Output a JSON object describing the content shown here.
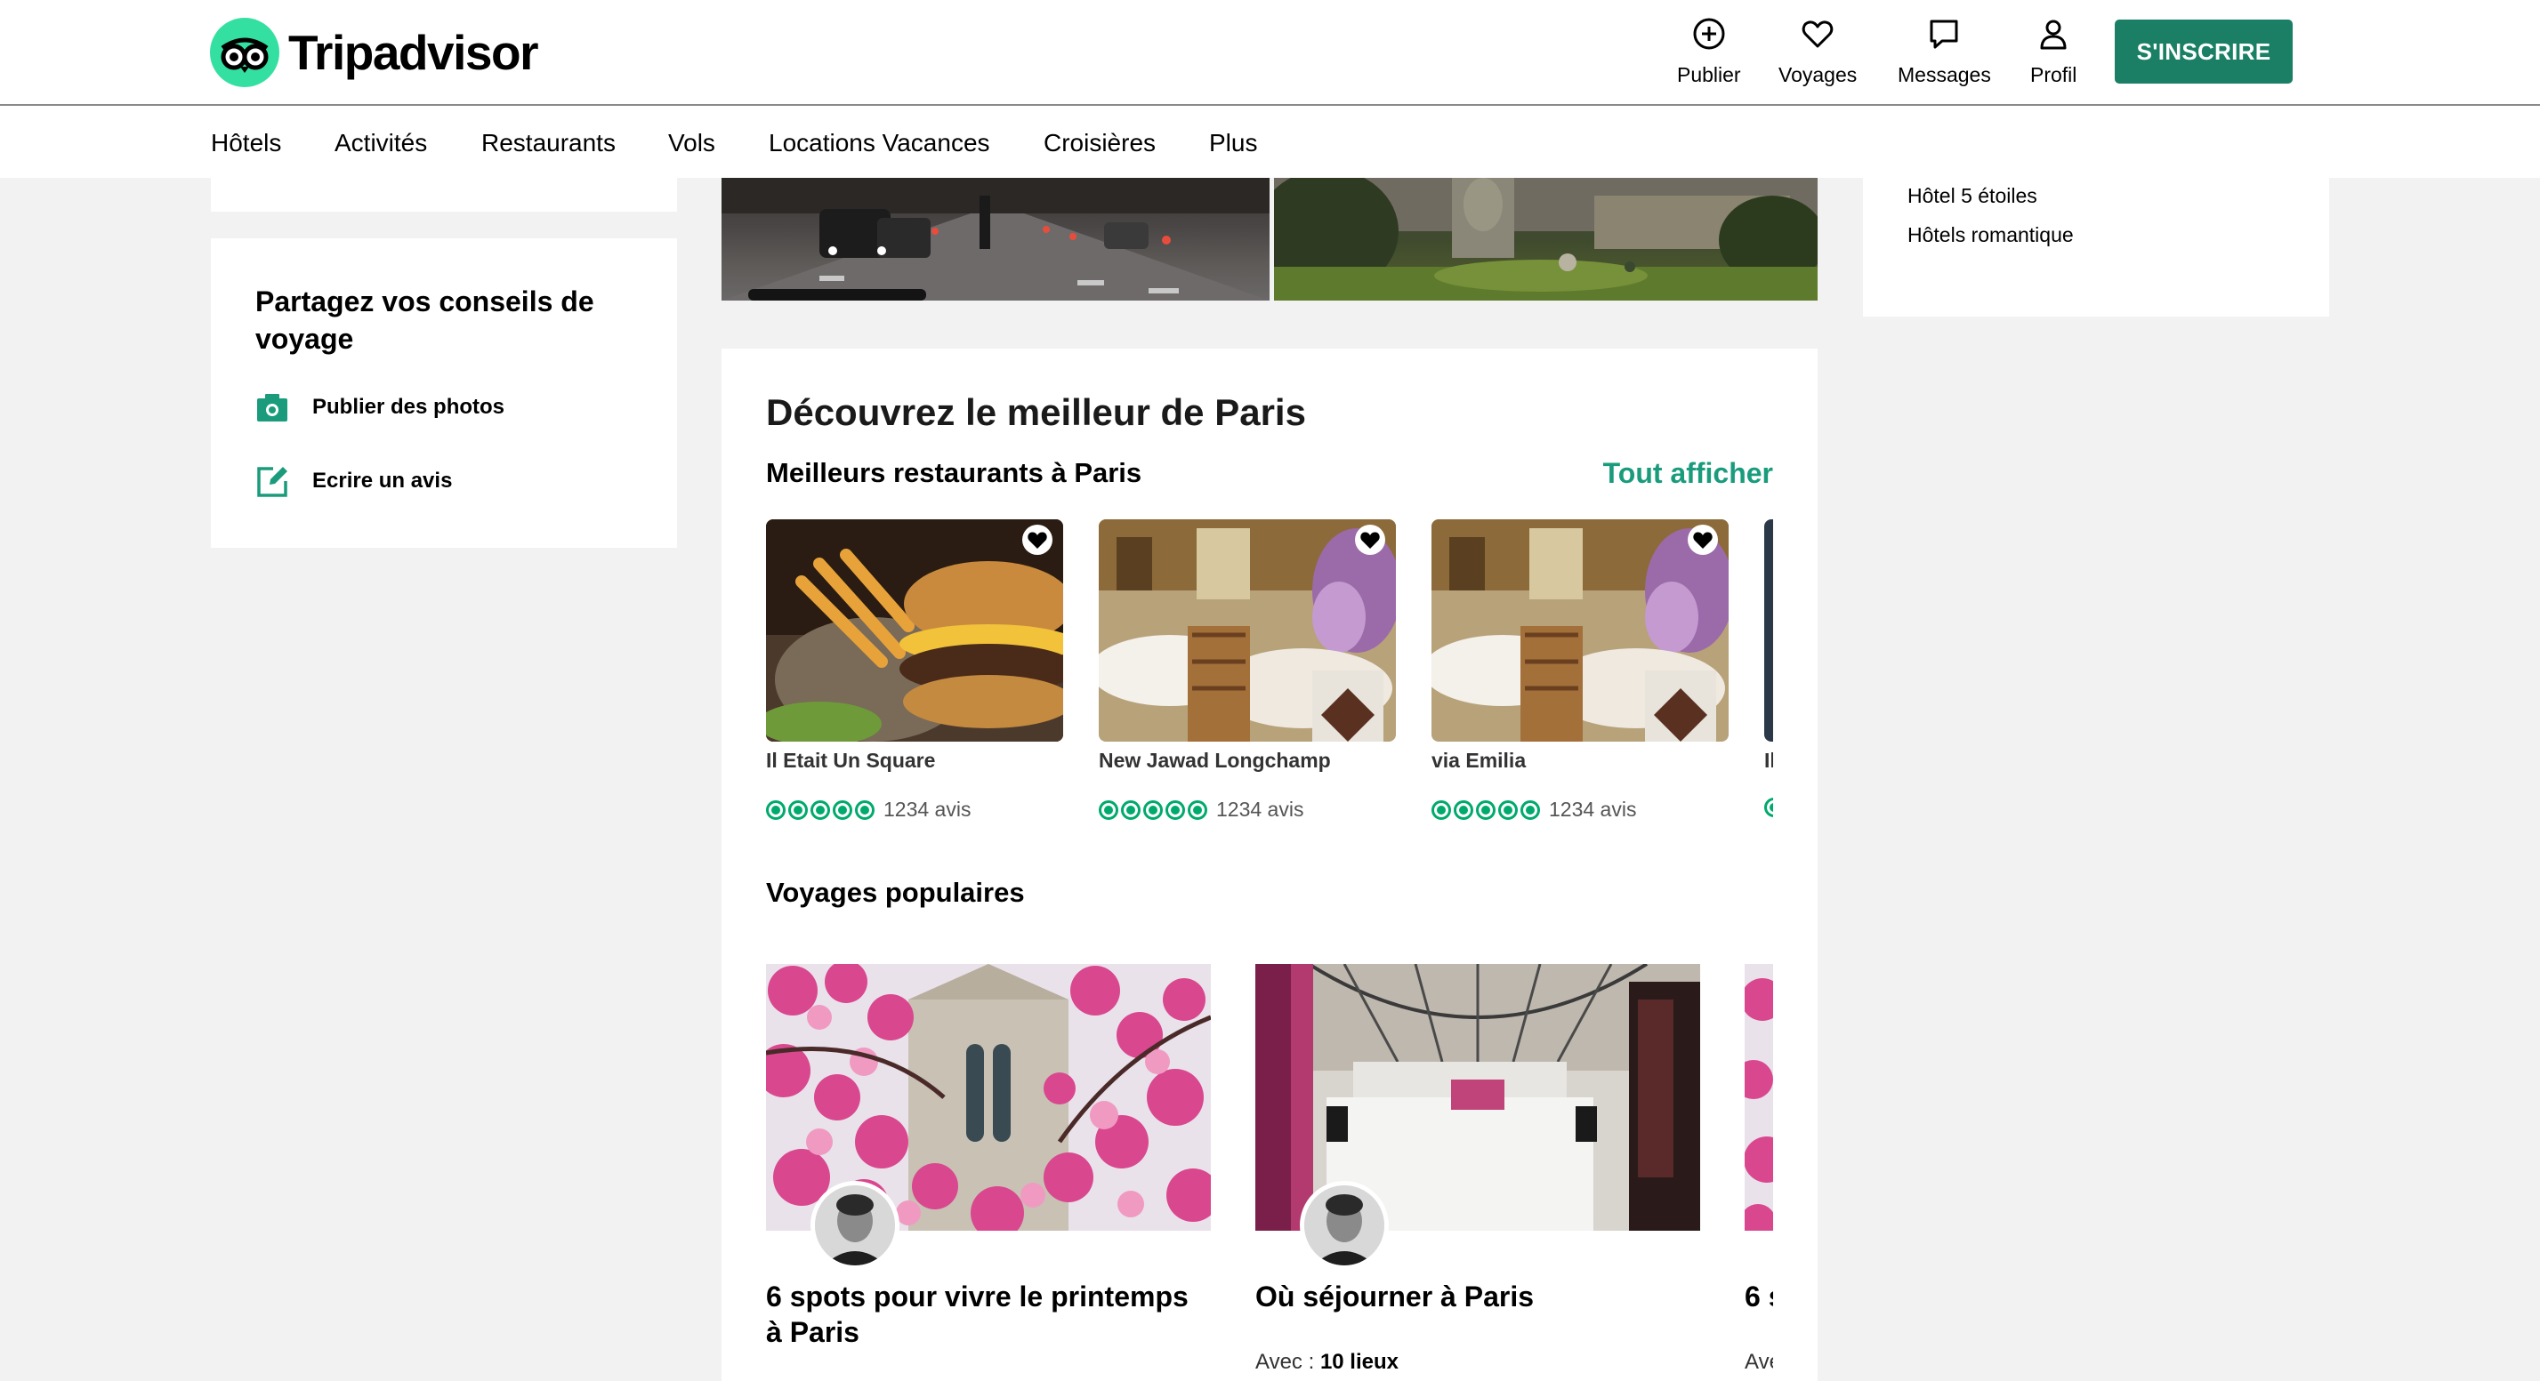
{
  "header": {
    "brand": "Tripadvisor",
    "actions": [
      {
        "label": "Publier",
        "icon": "plus-circle-icon"
      },
      {
        "label": "Voyages",
        "icon": "heart-icon"
      },
      {
        "label": "Messages",
        "icon": "chat-icon"
      },
      {
        "label": "Profil",
        "icon": "user-icon"
      }
    ],
    "signup_label": "S'INSCRIRE",
    "brand_color": "#34e0a1",
    "button_color": "#1a7f64"
  },
  "nav": {
    "items": [
      "Hôtels",
      "Activités",
      "Restaurants",
      "Vols",
      "Locations Vacances",
      "Croisières",
      "Plus"
    ]
  },
  "sidebar": {
    "title": "Partagez vos conseils de voyage",
    "links": [
      {
        "label": "Publier des photos",
        "icon": "camera-icon"
      },
      {
        "label": "Ecrire un avis",
        "icon": "edit-icon"
      }
    ]
  },
  "right_sidebar": {
    "links": [
      "Hôtel 5 étoiles",
      "Hôtels romantique"
    ]
  },
  "main": {
    "title": "Découvrez le meilleur de Paris",
    "restaurants_title": "Meilleurs restaurants à Paris",
    "see_all": "Tout afficher",
    "restaurants": [
      {
        "name": "Il Etait Un Square",
        "reviews": "1234 avis",
        "rating": 5
      },
      {
        "name": "New Jawad Longchamp",
        "reviews": "1234 avis",
        "rating": 5
      },
      {
        "name": "via Emilia",
        "reviews": "1234 avis",
        "rating": 5
      },
      {
        "name": "Il",
        "reviews": "",
        "rating": 5
      }
    ],
    "voyages_title": "Voyages populaires",
    "voyages": [
      {
        "title": "6 spots pour vivre le printemps à Paris",
        "with_label": "",
        "places": ""
      },
      {
        "title": "Où séjourner à Paris",
        "with_label": "Avec :",
        "places": "10 lieux"
      },
      {
        "title": "6 s",
        "with_label": "Ave",
        "places": ""
      }
    ],
    "accent_color": "#1a9c7c",
    "rating_color": "#00aa6c"
  }
}
